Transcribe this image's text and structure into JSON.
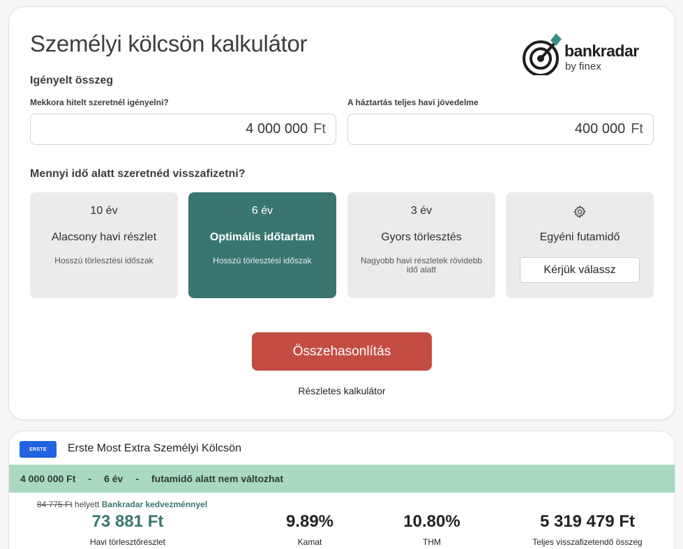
{
  "header": {
    "title": "Személyi kölcsön kalkulátor",
    "logo_name": "bankradar",
    "logo_sub": "by finex"
  },
  "amount_section": {
    "label": "Igényelt összeg",
    "loan": {
      "label": "Mekkora hitelt szeretnél igényelni?",
      "value": "4 000 000",
      "unit": "Ft"
    },
    "income": {
      "label": "A háztartás teljes havi jövedelme",
      "value": "400 000",
      "unit": "Ft"
    }
  },
  "term_section": {
    "question": "Mennyi idő alatt szeretnéd visszafizetni?",
    "options": [
      {
        "years": "10 év",
        "name": "Alacsony havi részlet",
        "desc": "Hosszú törlesztési időszak"
      },
      {
        "years": "6 év",
        "name": "Optimális időtartam",
        "desc": "Hosszú törlesztési időszak"
      },
      {
        "years": "3 év",
        "name": "Gyors törlesztés",
        "desc": "Nagyobb havi részletek rövidebb idő alatt"
      },
      {
        "name": "Egyéni futamidő",
        "button": "Kérjük válassz"
      }
    ]
  },
  "actions": {
    "compare": "Összehasonlítás",
    "detailed": "Részletes kalkulátor"
  },
  "offer": {
    "bank_logo_text": "ERSTE",
    "product": "Erste Most Extra Személyi Kölcsön",
    "stripe": {
      "amount": "4 000 000 Ft",
      "sep1": "-",
      "term": "6 év",
      "sep2": "-",
      "note": "futamidő alatt nem változhat"
    },
    "old_price": "84 775 Ft",
    "old_price_mid": "helyett",
    "old_price_note": "Bankradar kedvezménnyel",
    "metrics": [
      {
        "value": "73 881 Ft",
        "label": "Havi törlesztőrészlet"
      },
      {
        "value": "9.89%",
        "label": "Kamat"
      },
      {
        "value": "10.80%",
        "label": "THM"
      },
      {
        "value": "5 319 479 Ft",
        "label": "Teljes visszafizetendő összeg"
      }
    ]
  },
  "colors": {
    "accent": "#39766f",
    "cta": "#c44d43",
    "stripe": "#a9d9c1",
    "bank": "#2163e0"
  }
}
